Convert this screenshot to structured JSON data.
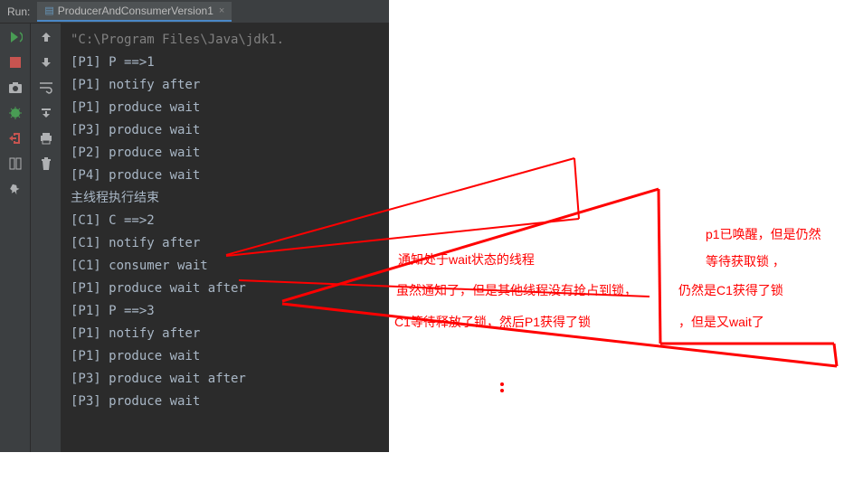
{
  "header": {
    "run_label": "Run:",
    "tab_name": "ProducerAndConsumerVersion1",
    "tab_close": "×"
  },
  "console_lines": [
    {
      "text": "\"C:\\Program Files\\Java\\jdk1.",
      "cls": "path-line"
    },
    {
      "text": "[P1] P ==>1",
      "cls": ""
    },
    {
      "text": "[P1] notify after",
      "cls": ""
    },
    {
      "text": "[P1] produce wait",
      "cls": ""
    },
    {
      "text": "[P3] produce wait",
      "cls": ""
    },
    {
      "text": "[P2] produce wait",
      "cls": ""
    },
    {
      "text": "[P4] produce wait",
      "cls": ""
    },
    {
      "text": "主线程执行结束",
      "cls": "cn-line"
    },
    {
      "text": "[C1] C ==>2",
      "cls": ""
    },
    {
      "text": "[C1] notify after",
      "cls": ""
    },
    {
      "text": "[C1] consumer wait",
      "cls": ""
    },
    {
      "text": "[P1] produce wait after",
      "cls": ""
    },
    {
      "text": "[P1] P ==>3",
      "cls": ""
    },
    {
      "text": "[P1] notify after",
      "cls": ""
    },
    {
      "text": "[P1] produce wait",
      "cls": ""
    },
    {
      "text": "[P3] produce wait after",
      "cls": ""
    },
    {
      "text": "[P3] produce wait",
      "cls": ""
    }
  ],
  "annotations": {
    "note1": "通知处于wait状态的线程",
    "note2": "虽然通知了，但是其他线程没有抢占到锁，",
    "note3": "C1等待释放了锁，然后P1获得了锁",
    "note4_l1": "p1已唤醒，但是仍然",
    "note4_l2": "等待获取锁 ，",
    "note4_l3": "仍然是C1获得了锁",
    "note4_l4": "，但是又wait了"
  },
  "colors": {
    "accent": "#ff0000",
    "console_bg": "#2b2b2b",
    "ide_bg": "#3c3f41",
    "text": "#a9b7c6"
  }
}
